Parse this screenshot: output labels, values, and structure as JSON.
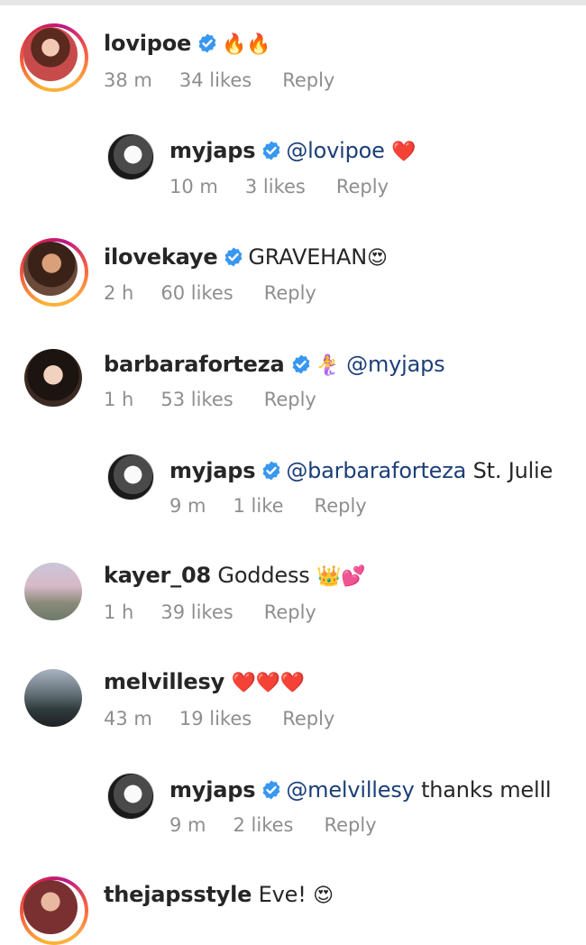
{
  "comments": [
    {
      "user": "lovipoe",
      "verified": true,
      "text": "",
      "emoji": "🔥🔥",
      "time": "38 m",
      "likes": "34 likes",
      "reply": "Reply"
    },
    {
      "user": "myjaps",
      "verified": true,
      "mention": "@lovipoe",
      "text": "",
      "emoji": "❤️",
      "time": "10 m",
      "likes": "3 likes",
      "reply": "Reply"
    },
    {
      "user": "ilovekaye",
      "verified": true,
      "text": "GRAVEHAN",
      "emoji": "😍",
      "time": "2 h",
      "likes": "60 likes",
      "reply": "Reply"
    },
    {
      "user": "barbaraforteza",
      "verified": true,
      "emoji": "🧜‍♀️",
      "mention": "@myjaps",
      "time": "1 h",
      "likes": "53 likes",
      "reply": "Reply"
    },
    {
      "user": "myjaps",
      "verified": true,
      "mention": "@barbaraforteza",
      "text": "St. Julie",
      "time": "9 m",
      "likes": "1 like",
      "reply": "Reply"
    },
    {
      "user": "kayer_08",
      "verified": false,
      "text": "Goddess",
      "emoji": "👑💕",
      "time": "1 h",
      "likes": "39 likes",
      "reply": "Reply"
    },
    {
      "user": "melvillesy",
      "verified": false,
      "emoji": "❤️❤️❤️",
      "time": "43 m",
      "likes": "19 likes",
      "reply": "Reply"
    },
    {
      "user": "myjaps",
      "verified": true,
      "mention": "@melvillesy",
      "text": "thanks melll",
      "time": "9 m",
      "likes": "2 likes",
      "reply": "Reply"
    },
    {
      "user": "thejapsstyle",
      "verified": false,
      "text": "Eve!",
      "emoji": "😍"
    }
  ],
  "colors": {
    "verified": "#3897f0",
    "mention": "#1b3f78",
    "meta": "#8e8e8e"
  },
  "icons": {
    "verified": "verified-badge-icon"
  }
}
